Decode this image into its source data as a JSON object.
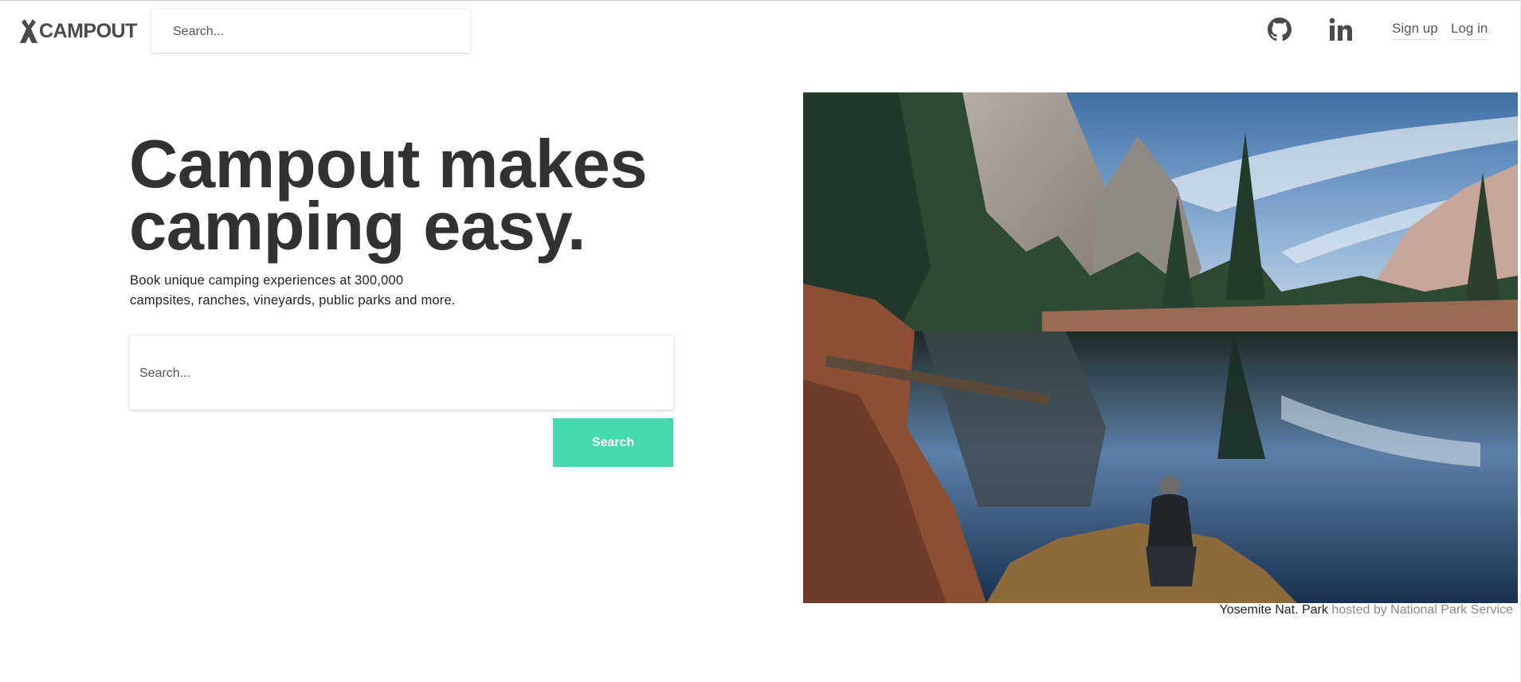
{
  "brand": {
    "name": "CAMPOUT",
    "logo_icon": "tent-icon"
  },
  "nav": {
    "search_placeholder": "Search...",
    "github_icon": "github-icon",
    "linkedin_icon": "linkedin-icon",
    "signup_label": "Sign up",
    "login_label": "Log in"
  },
  "hero": {
    "title_line1": "Campout makes",
    "title_line2": "camping easy.",
    "subtitle_line1": "Book unique camping experiences at 300,000",
    "subtitle_line2": "campsites, ranches, vineyards, public parks and more.",
    "search_placeholder": "Search...",
    "search_button": "Search"
  },
  "photo": {
    "caption_place": "Yosemite Nat. Park",
    "caption_host": "hosted by National Park Service"
  },
  "colors": {
    "accent": "#43d9ad",
    "heading": "#323232",
    "muted": "#8a8a8a"
  }
}
